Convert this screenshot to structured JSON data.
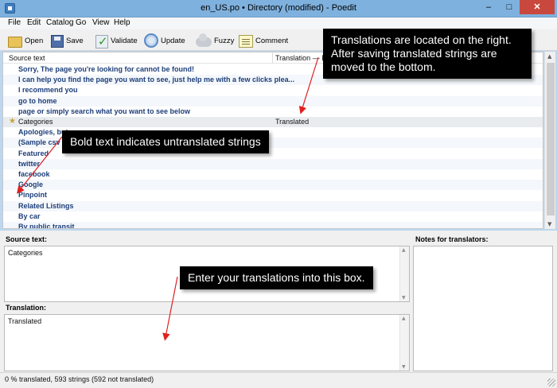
{
  "window": {
    "title": "en_US.po • Directory (modified) - Poedit",
    "minimize": "–",
    "maximize": "□",
    "close": "✕"
  },
  "menu": [
    "File",
    "Edit",
    "Catalog",
    "Go",
    "View",
    "Help"
  ],
  "toolbar": {
    "open": "Open",
    "save": "Save",
    "validate": "Validate",
    "update": "Update",
    "fuzzy": "Fuzzy",
    "comment": "Comment"
  },
  "list": {
    "col_source": "Source text",
    "col_translation": "Translation — E",
    "rows": [
      {
        "source": "Sorry, The page you're looking for cannot be found!",
        "translation": "",
        "untranslated": true
      },
      {
        "source": "I can help you find the page you want to see, just help me with a few clicks plea...",
        "translation": "",
        "untranslated": true
      },
      {
        "source": "I recommend you",
        "translation": "",
        "untranslated": true
      },
      {
        "source": "go to home",
        "translation": "",
        "untranslated": true
      },
      {
        "source": " page or simply search what you want to see below",
        "translation": "",
        "untranslated": true
      },
      {
        "source": "Categories",
        "translation": "Translated",
        "untranslated": false,
        "selected": true
      },
      {
        "source": "Apologies, but",
        "translation": "",
        "untranslated": true
      },
      {
        "source": "(Sample csv fi",
        "translation": "",
        "untranslated": true
      },
      {
        "source": "Featured",
        "translation": "",
        "untranslated": true
      },
      {
        "source": "twitter",
        "translation": "",
        "untranslated": true
      },
      {
        "source": "facebook",
        "translation": "",
        "untranslated": true
      },
      {
        "source": "Google",
        "translation": "",
        "untranslated": true
      },
      {
        "source": "Pinpoint",
        "translation": "",
        "untranslated": true
      },
      {
        "source": "Related Listings",
        "translation": "",
        "untranslated": true
      },
      {
        "source": "By car",
        "translation": "",
        "untranslated": true
      },
      {
        "source": "By public transit",
        "translation": "",
        "untranslated": true
      }
    ]
  },
  "editor": {
    "source_label": "Source text:",
    "source_value": "Categories",
    "translation_label": "Translation:",
    "translation_value": "Translated",
    "notes_label": "Notes for translators:"
  },
  "status": {
    "text": "0 % translated, 593 strings (592 not translated)"
  },
  "callouts": {
    "translations_right": "Translations are located on the right.\nAfter saving translated strings are\nmoved to the bottom.",
    "bold_untranslated": "Bold text indicates untranslated strings",
    "enter_translations": "Enter your translations into this box."
  },
  "colors": {
    "untranslated_text": "#1d3f7a",
    "arrow_red": "#e02020",
    "title_bar": "#7fb1de",
    "close_button": "#c9483d"
  }
}
